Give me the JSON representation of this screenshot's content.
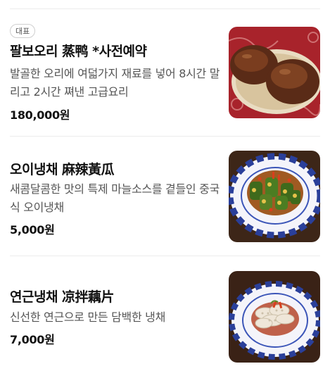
{
  "menu": {
    "items": [
      {
        "badge": "대표",
        "name": "팔보오리 蒸鸭 *사전예약",
        "description": "발골한 오리에 여덟가지 재료를 넣어 8시간 말리고 2시간 쪄낸 고급요리",
        "price": "180,000원",
        "image_icon": "duck-dish-photo"
      },
      {
        "name": "오이냉채 麻辣黃瓜",
        "description": "새콤달콤한 맛의 특제 마늘소스를 곁들인 중국식 오이냉채",
        "price": "5,000원",
        "image_icon": "cucumber-salad-photo"
      },
      {
        "name": "연근냉채 凉拌藕片",
        "description": "신선한 연근으로 만든 담백한 냉채",
        "price": "7,000원",
        "image_icon": "lotus-root-salad-photo"
      }
    ]
  },
  "colors": {
    "text": "#111111",
    "description": "#555555",
    "divider": "#ececec"
  }
}
